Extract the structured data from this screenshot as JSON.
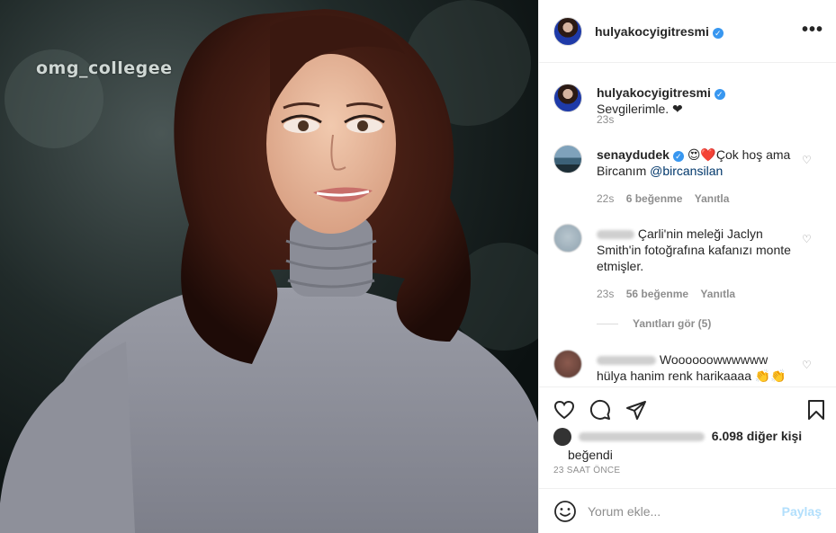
{
  "photo": {
    "watermark": "omg_collegee"
  },
  "header": {
    "username": "hulyakocyigitresmi",
    "more_icon": "more-options-icon"
  },
  "caption": {
    "username": "hulyakocyigitresmi",
    "text": "Sevgilerimle. ❤",
    "time": "23s"
  },
  "comments": [
    {
      "username": "senaydudek",
      "text_lead": "😍❤️Çok hoş ama Bircanım ",
      "mention": "@bircansilan",
      "time": "22s",
      "likes": "6 beğenme",
      "reply": "Yanıtla"
    },
    {
      "text": "Çarli'nin meleği Jaclyn Smith'in fotoğrafına kafanızı monte etmişler.",
      "time": "23s",
      "likes": "56 beğenme",
      "reply": "Yanıtla",
      "view_replies": "Yanıtları gör (5)"
    },
    {
      "text": "Woooooowwwwww hülya hanim renk harikaaaa 👏👏"
    }
  ],
  "likes": {
    "count": "6.098 diğer kişi",
    "suffix": "beğendi"
  },
  "timestamp": "23 SAAT ÖNCE",
  "add_comment": {
    "placeholder": "Yorum ekle...",
    "share": "Paylaş"
  },
  "colors": {
    "accent": "#3897f0",
    "share_disabled": "#b2dffc",
    "muted": "#8e8e8e"
  }
}
